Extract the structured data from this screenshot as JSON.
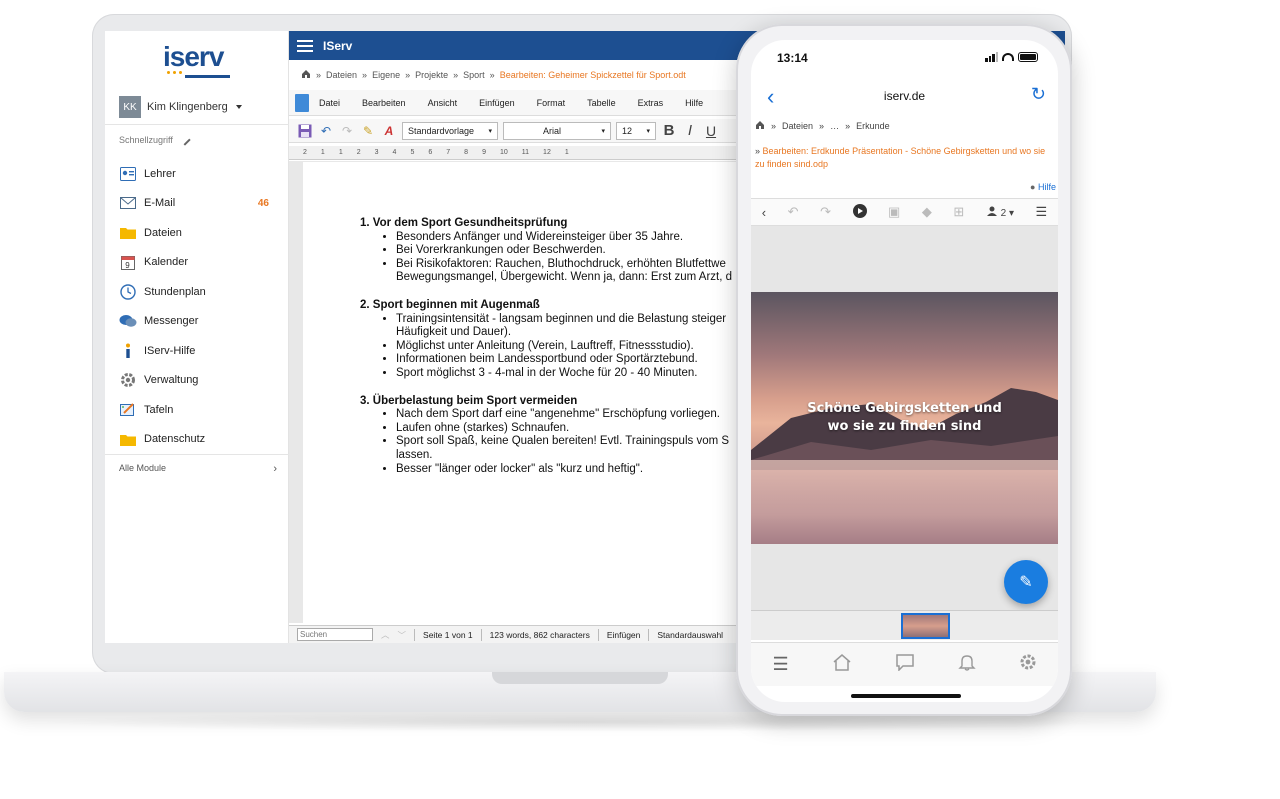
{
  "laptop": {
    "logo": "iserv",
    "user": {
      "initials": "KK",
      "name": "Kim Klingenberg"
    },
    "quick_access": "Schnellzugriff",
    "nav": [
      {
        "label": "Lehrer",
        "icon": "teacher-icon",
        "badge": ""
      },
      {
        "label": "E-Mail",
        "icon": "mail-icon",
        "badge": "46"
      },
      {
        "label": "Dateien",
        "icon": "folder-icon",
        "badge": ""
      },
      {
        "label": "Kalender",
        "icon": "calendar-icon",
        "badge": ""
      },
      {
        "label": "Stundenplan",
        "icon": "clock-icon",
        "badge": ""
      },
      {
        "label": "Messenger",
        "icon": "chat-icon",
        "badge": ""
      },
      {
        "label": "IServ-Hilfe",
        "icon": "help-icon",
        "badge": ""
      },
      {
        "label": "Verwaltung",
        "icon": "gear-icon",
        "badge": ""
      },
      {
        "label": "Tafeln",
        "icon": "board-icon",
        "badge": ""
      },
      {
        "label": "Datenschutz",
        "icon": "folder-icon",
        "badge": ""
      }
    ],
    "all_modules": "Alle Module",
    "app_title": "IServ",
    "breadcrumb": [
      "Dateien",
      "Eigene",
      "Projekte",
      "Sport"
    ],
    "breadcrumb_active": "Bearbeiten: Geheimer Spickzettel für Sport.odt",
    "menu": [
      "Datei",
      "Bearbeiten",
      "Ansicht",
      "Einfügen",
      "Format",
      "Tabelle",
      "Extras",
      "Hilfe"
    ],
    "toolbar": {
      "style": "Standardvorlage",
      "font": "Arial",
      "size": "12"
    },
    "ruler": [
      "2",
      "1",
      "1",
      "2",
      "3",
      "4",
      "5",
      "6",
      "7",
      "8",
      "9",
      "10",
      "11",
      "12",
      "1"
    ],
    "document": [
      {
        "heading": "1. Vor dem Sport Gesundheitsprüfung",
        "items": [
          "Besonders Anfänger und Widereinsteiger über 35 Jahre.",
          "Bei Vorerkrankungen oder Beschwerden.",
          "Bei Risikofaktoren: Rauchen, Bluthochdruck, erhöhten Blutfettwe",
          "Bewegungsmangel, Übergewicht. Wenn ja, dann: Erst zum Arzt, d"
        ]
      },
      {
        "heading": "2. Sport beginnen mit Augenmaß",
        "items": [
          "Trainingsintensität - langsam beginnen und die Belastung steiger",
          "Häufigkeit und Dauer).",
          "Möglichst unter Anleitung (Verein, Lauftreff, Fitnessstudio).",
          "Informationen beim Landessportbund oder Sportärztebund.",
          "Sport möglichst 3 - 4-mal in der Woche für 20 - 40 Minuten."
        ]
      },
      {
        "heading": "3. Überbelastung beim Sport vermeiden",
        "items": [
          "Nach dem Sport darf eine \"angenehme\" Erschöpfung vorliegen.",
          "Laufen ohne (starkes) Schnaufen.",
          "Sport soll Spaß, keine Qualen bereiten! Evtl. Trainingspuls vom S",
          "lassen.",
          "Besser \"länger oder locker\" als \"kurz und heftig\"."
        ]
      }
    ],
    "status": {
      "search_placeholder": "Suchen",
      "page": "Seite 1 von 1",
      "words": "123 words, 862 characters",
      "mode": "Einfügen",
      "selection": "Standardauswahl"
    }
  },
  "phone": {
    "time": "13:14",
    "domain": "iserv.de",
    "breadcrumb": [
      "Dateien",
      "…",
      "Erkunde"
    ],
    "file_title": "Bearbeiten: Erdkunde Präsentation - Schöne Gebirgsketten und wo sie zu finden sind.odp",
    "help": "Hilfe",
    "users_count": "2",
    "slide_text_line1": "Schöne Gebirgsketten und",
    "slide_text_line2": "wo sie zu finden sind"
  },
  "colors": {
    "brand": "#1d4f91",
    "accent": "#e87722",
    "link": "#1a6fd4"
  }
}
